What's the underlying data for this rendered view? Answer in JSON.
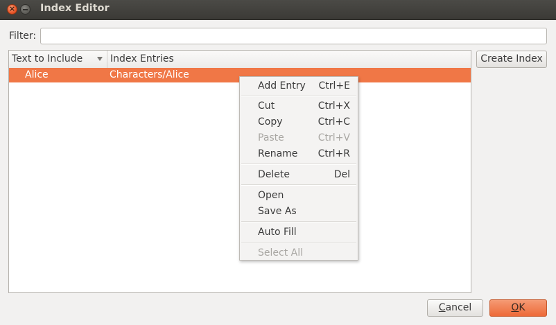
{
  "window": {
    "title": "Index Editor"
  },
  "filter": {
    "label": "Filter:",
    "value": ""
  },
  "table": {
    "columns": [
      "Text to Include",
      "Index Entries"
    ],
    "rows": [
      {
        "text": "Alice",
        "entry": "Characters/Alice"
      }
    ]
  },
  "buttons": {
    "create_index": "Create Index",
    "cancel": "Cancel",
    "ok": "OK"
  },
  "context_menu": {
    "items": [
      {
        "label": "Add Entry",
        "shortcut": "Ctrl+E"
      },
      {
        "label": "Cut",
        "shortcut": "Ctrl+X"
      },
      {
        "label": "Copy",
        "shortcut": "Ctrl+C"
      },
      {
        "label": "Paste",
        "shortcut": "Ctrl+V",
        "disabled": true
      },
      {
        "label": "Rename",
        "shortcut": "Ctrl+R"
      },
      {
        "label": "Delete",
        "shortcut": "Del"
      },
      {
        "label": "Open",
        "shortcut": ""
      },
      {
        "label": "Save As",
        "shortcut": ""
      },
      {
        "label": "Auto Fill",
        "shortcut": ""
      },
      {
        "label": "Select All",
        "shortcut": "",
        "disabled": true
      }
    ]
  },
  "colors": {
    "accent": "#f07746",
    "titlebar": "#3c3b37"
  }
}
